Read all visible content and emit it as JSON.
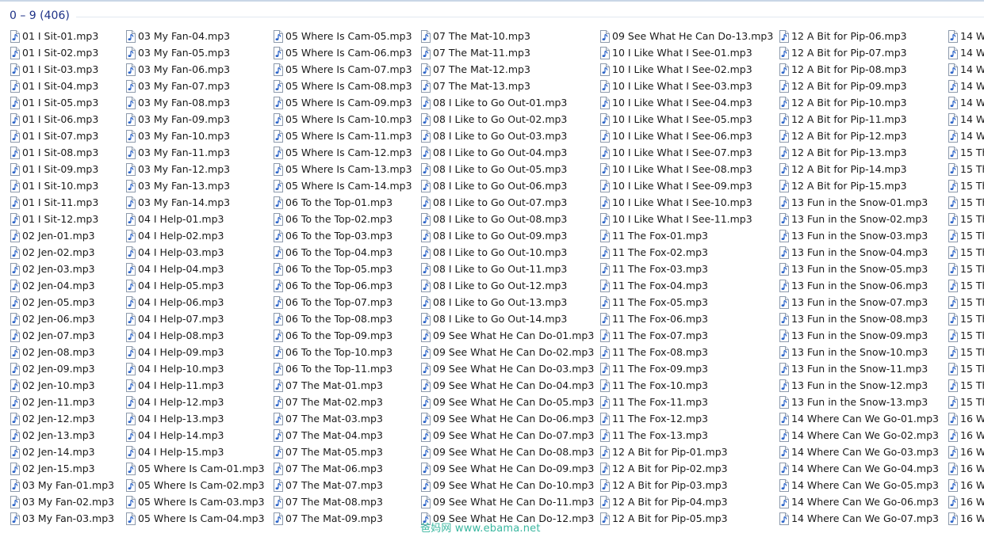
{
  "group": {
    "title": "0 – 9 (406)"
  },
  "columns": [
    {
      "items": [
        "01 I Sit-01.mp3",
        "01 I Sit-02.mp3",
        "01 I Sit-03.mp3",
        "01 I Sit-04.mp3",
        "01 I Sit-05.mp3",
        "01 I Sit-06.mp3",
        "01 I Sit-07.mp3",
        "01 I Sit-08.mp3",
        "01 I Sit-09.mp3",
        "01 I Sit-10.mp3",
        "01 I Sit-11.mp3",
        "01 I Sit-12.mp3",
        "02 Jen-01.mp3",
        "02 Jen-02.mp3",
        "02 Jen-03.mp3",
        "02 Jen-04.mp3",
        "02 Jen-05.mp3",
        "02 Jen-06.mp3",
        "02 Jen-07.mp3",
        "02 Jen-08.mp3",
        "02 Jen-09.mp3",
        "02 Jen-10.mp3",
        "02 Jen-11.mp3",
        "02 Jen-12.mp3",
        "02 Jen-13.mp3",
        "02 Jen-14.mp3",
        "02 Jen-15.mp3",
        "03 My Fan-01.mp3",
        "03 My Fan-02.mp3",
        "03 My Fan-03.mp3"
      ]
    },
    {
      "items": [
        "03 My Fan-04.mp3",
        "03 My Fan-05.mp3",
        "03 My Fan-06.mp3",
        "03 My Fan-07.mp3",
        "03 My Fan-08.mp3",
        "03 My Fan-09.mp3",
        "03 My Fan-10.mp3",
        "03 My Fan-11.mp3",
        "03 My Fan-12.mp3",
        "03 My Fan-13.mp3",
        "03 My Fan-14.mp3",
        "04 I Help-01.mp3",
        "04 I Help-02.mp3",
        "04 I Help-03.mp3",
        "04 I Help-04.mp3",
        "04 I Help-05.mp3",
        "04 I Help-06.mp3",
        "04 I Help-07.mp3",
        "04 I Help-08.mp3",
        "04 I Help-09.mp3",
        "04 I Help-10.mp3",
        "04 I Help-11.mp3",
        "04 I Help-12.mp3",
        "04 I Help-13.mp3",
        "04 I Help-14.mp3",
        "04 I Help-15.mp3",
        "05 Where Is Cam-01.mp3",
        "05 Where Is Cam-02.mp3",
        "05 Where Is Cam-03.mp3",
        "05 Where Is Cam-04.mp3"
      ]
    },
    {
      "items": [
        "05 Where Is Cam-05.mp3",
        "05 Where Is Cam-06.mp3",
        "05 Where Is Cam-07.mp3",
        "05 Where Is Cam-08.mp3",
        "05 Where Is Cam-09.mp3",
        "05 Where Is Cam-10.mp3",
        "05 Where Is Cam-11.mp3",
        "05 Where Is Cam-12.mp3",
        "05 Where Is Cam-13.mp3",
        "05 Where Is Cam-14.mp3",
        "06 To the Top-01.mp3",
        "06 To the Top-02.mp3",
        "06 To the Top-03.mp3",
        "06 To the Top-04.mp3",
        "06 To the Top-05.mp3",
        "06 To the Top-06.mp3",
        "06 To the Top-07.mp3",
        "06 To the Top-08.mp3",
        "06 To the Top-09.mp3",
        "06 To the Top-10.mp3",
        "06 To the Top-11.mp3",
        "07 The Mat-01.mp3",
        "07 The Mat-02.mp3",
        "07 The Mat-03.mp3",
        "07 The Mat-04.mp3",
        "07 The Mat-05.mp3",
        "07 The Mat-06.mp3",
        "07 The Mat-07.mp3",
        "07 The Mat-08.mp3",
        "07 The Mat-09.mp3"
      ]
    },
    {
      "items": [
        "07 The Mat-10.mp3",
        "07 The Mat-11.mp3",
        "07 The Mat-12.mp3",
        "07 The Mat-13.mp3",
        "08 I Like to Go Out-01.mp3",
        "08 I Like to Go Out-02.mp3",
        "08 I Like to Go Out-03.mp3",
        "08 I Like to Go Out-04.mp3",
        "08 I Like to Go Out-05.mp3",
        "08 I Like to Go Out-06.mp3",
        "08 I Like to Go Out-07.mp3",
        "08 I Like to Go Out-08.mp3",
        "08 I Like to Go Out-09.mp3",
        "08 I Like to Go Out-10.mp3",
        "08 I Like to Go Out-11.mp3",
        "08 I Like to Go Out-12.mp3",
        "08 I Like to Go Out-13.mp3",
        "08 I Like to Go Out-14.mp3",
        "09 See What He Can Do-01.mp3",
        "09 See What He Can Do-02.mp3",
        "09 See What He Can Do-03.mp3",
        "09 See What He Can Do-04.mp3",
        "09 See What He Can Do-05.mp3",
        "09 See What He Can Do-06.mp3",
        "09 See What He Can Do-07.mp3",
        "09 See What He Can Do-08.mp3",
        "09 See What He Can Do-09.mp3",
        "09 See What He Can Do-10.mp3",
        "09 See What He Can Do-11.mp3",
        "09 See What He Can Do-12.mp3"
      ]
    },
    {
      "items": [
        "09 See What He Can Do-13.mp3",
        "10 I Like What I See-01.mp3",
        "10 I Like What I See-02.mp3",
        "10 I Like What I See-03.mp3",
        "10 I Like What I See-04.mp3",
        "10 I Like What I See-05.mp3",
        "10 I Like What I See-06.mp3",
        "10 I Like What I See-07.mp3",
        "10 I Like What I See-08.mp3",
        "10 I Like What I See-09.mp3",
        "10 I Like What I See-10.mp3",
        "10 I Like What I See-11.mp3",
        "11 The Fox-01.mp3",
        "11 The Fox-02.mp3",
        "11 The Fox-03.mp3",
        "11 The Fox-04.mp3",
        "11 The Fox-05.mp3",
        "11 The Fox-06.mp3",
        "11 The Fox-07.mp3",
        "11 The Fox-08.mp3",
        "11 The Fox-09.mp3",
        "11 The Fox-10.mp3",
        "11 The Fox-11.mp3",
        "11 The Fox-12.mp3",
        "11 The Fox-13.mp3",
        "12 A Bit for Pip-01.mp3",
        "12 A Bit for Pip-02.mp3",
        "12 A Bit for Pip-03.mp3",
        "12 A Bit for Pip-04.mp3",
        "12 A Bit for Pip-05.mp3"
      ]
    },
    {
      "items": [
        "12 A Bit for Pip-06.mp3",
        "12 A Bit for Pip-07.mp3",
        "12 A Bit for Pip-08.mp3",
        "12 A Bit for Pip-09.mp3",
        "12 A Bit for Pip-10.mp3",
        "12 A Bit for Pip-11.mp3",
        "12 A Bit for Pip-12.mp3",
        "12 A Bit for Pip-13.mp3",
        "12 A Bit for Pip-14.mp3",
        "12 A Bit for Pip-15.mp3",
        "13 Fun in the Snow-01.mp3",
        "13 Fun in the Snow-02.mp3",
        "13 Fun in the Snow-03.mp3",
        "13 Fun in the Snow-04.mp3",
        "13 Fun in the Snow-05.mp3",
        "13 Fun in the Snow-06.mp3",
        "13 Fun in the Snow-07.mp3",
        "13 Fun in the Snow-08.mp3",
        "13 Fun in the Snow-09.mp3",
        "13 Fun in the Snow-10.mp3",
        "13 Fun in the Snow-11.mp3",
        "13 Fun in the Snow-12.mp3",
        "13 Fun in the Snow-13.mp3",
        "14 Where Can We Go-01.mp3",
        "14 Where Can We Go-02.mp3",
        "14 Where Can We Go-03.mp3",
        "14 Where Can We Go-04.mp3",
        "14 Where Can We Go-05.mp3",
        "14 Where Can We Go-06.mp3",
        "14 Where Can We Go-07.mp3"
      ]
    },
    {
      "items": [
        "14 W",
        "14 W",
        "14 W",
        "14 W",
        "14 W",
        "14 W",
        "14 W",
        "15 Th",
        "15 Th",
        "15 Th",
        "15 Th",
        "15 Th",
        "15 Th",
        "15 Th",
        "15 Th",
        "15 Th",
        "15 Th",
        "15 Th",
        "15 Th",
        "15 Th",
        "15 Th",
        "15 Th",
        "15 Th",
        "16 W",
        "16 W",
        "16 W",
        "16 W",
        "16 W",
        "16 W",
        "16 W"
      ]
    }
  ],
  "icons": {
    "file": "audio-file-icon"
  },
  "colors": {
    "group_title": "#1e3287",
    "icon_note": "#2a63c9",
    "watermark": "#3bb7a0"
  },
  "watermark": "爸妈网 www.ebama.net"
}
